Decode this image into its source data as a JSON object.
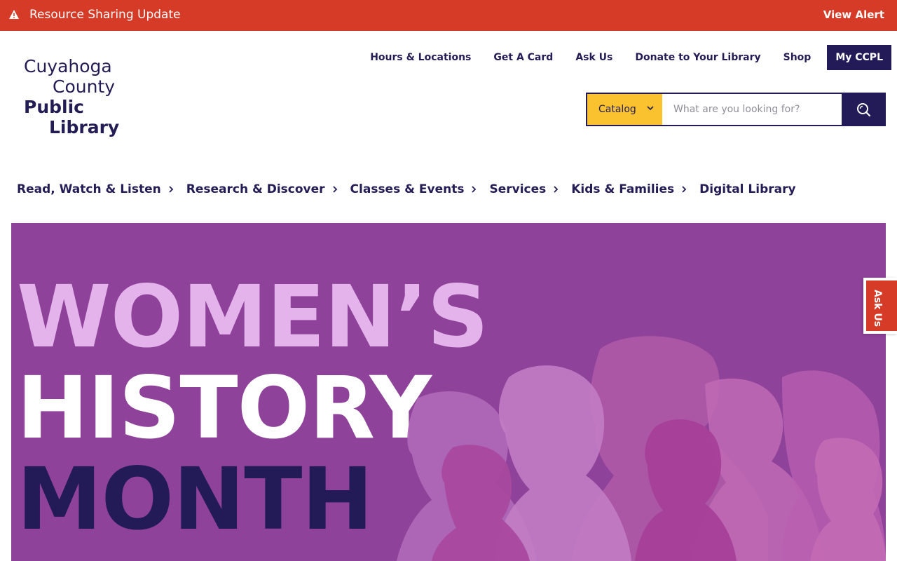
{
  "alert": {
    "title": "Resource Sharing Update",
    "link_label": "View Alert",
    "icon": "warning-icon",
    "color": "#d63b27"
  },
  "logo": {
    "line1": "Cuyahoga",
    "line2": "County",
    "line3": "Public",
    "line4": "Library"
  },
  "utility_nav": {
    "items": [
      {
        "label": "Hours & Locations"
      },
      {
        "label": "Get A Card"
      },
      {
        "label": "Ask Us"
      },
      {
        "label": "Donate to Your Library"
      },
      {
        "label": "Shop"
      }
    ],
    "account_button": "My CCPL"
  },
  "search": {
    "scope_selected": "Catalog",
    "placeholder": "What are you looking for?",
    "button_icon": "search-icon"
  },
  "main_nav": {
    "items": [
      {
        "label": "Read, Watch & Listen",
        "has_submenu": true
      },
      {
        "label": "Research & Discover",
        "has_submenu": true
      },
      {
        "label": "Classes & Events",
        "has_submenu": true
      },
      {
        "label": "Services",
        "has_submenu": true
      },
      {
        "label": "Kids & Families",
        "has_submenu": true
      },
      {
        "label": "Digital Library",
        "has_submenu": false
      }
    ]
  },
  "hero": {
    "line1": "WOMEN’S",
    "line2": "HISTORY",
    "line3": "MONTH",
    "background_color": "#8e4299"
  },
  "ask_tab": {
    "label": "Ask Us"
  },
  "colors": {
    "navy": "#231a58",
    "alert_red": "#d63b27",
    "catalog_yellow": "#f9c22e",
    "hero_purple": "#8e4299",
    "hero_pink": "#e5b3ec"
  }
}
